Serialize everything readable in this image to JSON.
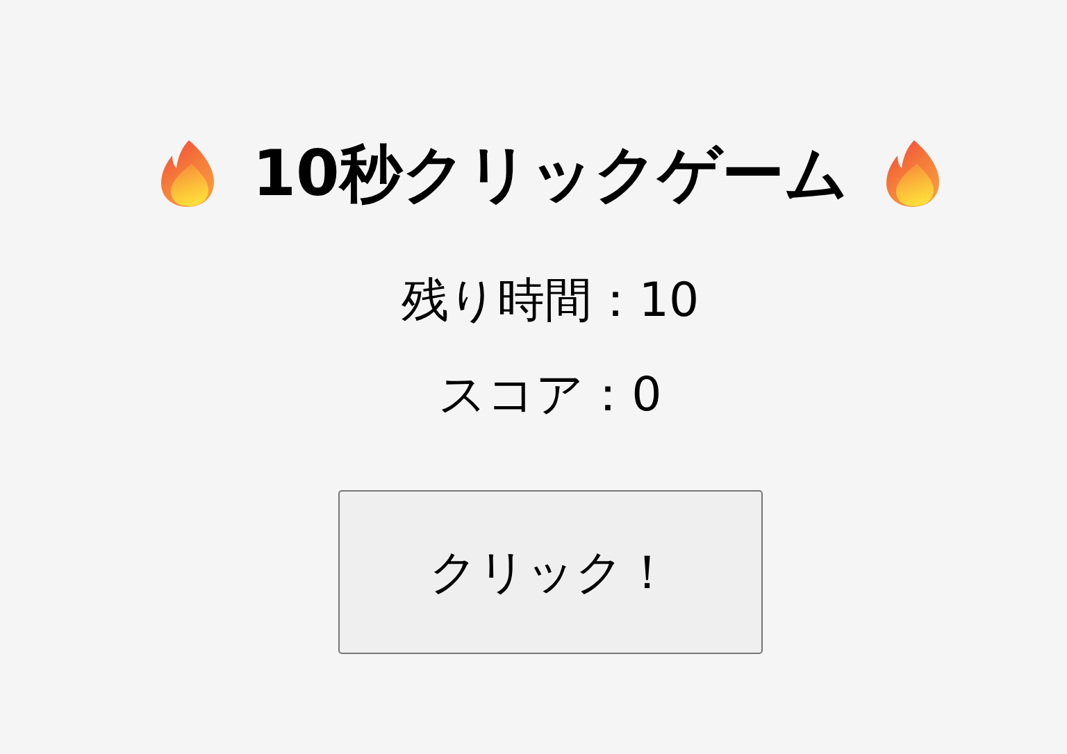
{
  "title": "10秒クリックゲーム",
  "timer": "残り時間：10",
  "score": "スコア：0",
  "button": "クリック！"
}
